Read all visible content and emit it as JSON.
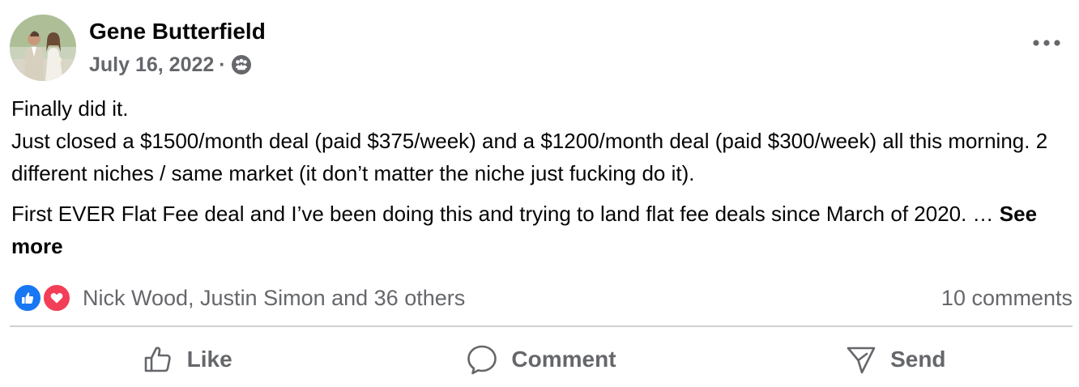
{
  "post": {
    "author": "Gene Butterfield",
    "date": "July 16, 2022",
    "separator": "·",
    "audience_icon": "group-icon",
    "more_icon": "more-horizontal-icon",
    "paragraphs": [
      "Finally did it.",
      "Just closed a $1500/month deal (paid $375/week) and a $1200/month deal (paid $300/week) all this morning. 2 different niches / same market (it don’t matter the niche just fucking do it).",
      "First EVER Flat Fee deal and I’ve been doing this and trying to land flat fee deals since March of 2020. … "
    ],
    "see_more": "See more"
  },
  "reactions": {
    "icons": [
      "like-reaction-icon",
      "love-reaction-icon"
    ],
    "summary": "Nick Wood, Justin Simon and 36 others",
    "comments": "10 comments"
  },
  "actions": {
    "like": "Like",
    "comment": "Comment",
    "send": "Send"
  },
  "colors": {
    "text_primary": "#050505",
    "text_secondary": "#65676b",
    "like_blue": "#1877f2",
    "love_red": "#f33e58",
    "divider": "#ced0d4"
  }
}
